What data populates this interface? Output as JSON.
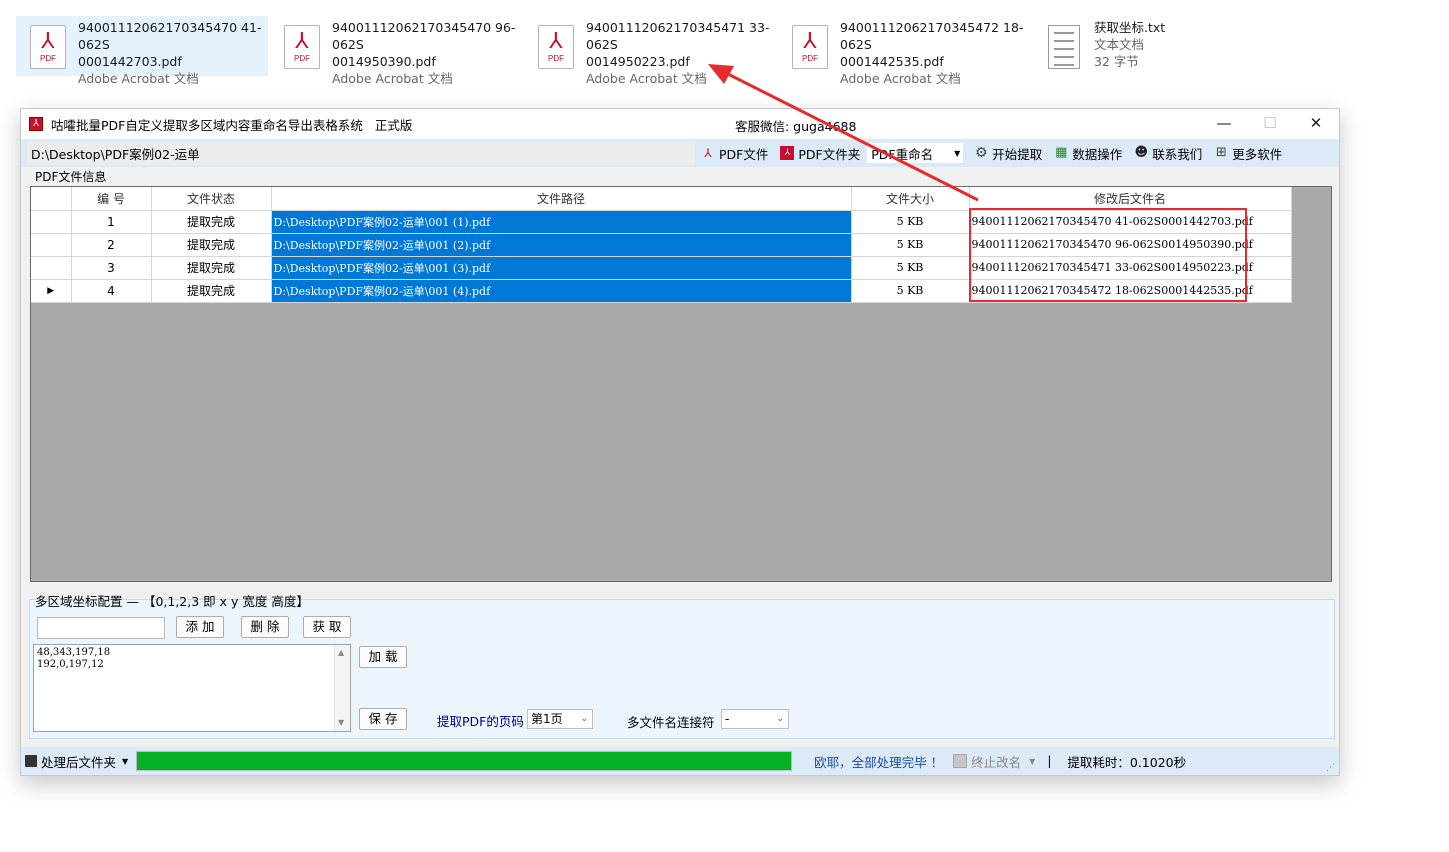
{
  "explorer": {
    "files": [
      {
        "name_line1": "94001112062170345470 41-062S",
        "name_line2": "0001442703.pdf",
        "type": "Adobe Acrobat 文档",
        "icon": "pdf-icon",
        "selected": true
      },
      {
        "name_line1": "94001112062170345470 96-062S",
        "name_line2": "0014950390.pdf",
        "type": "Adobe Acrobat 文档",
        "icon": "pdf-icon"
      },
      {
        "name_line1": "94001112062170345471 33-062S",
        "name_line2": "0014950223.pdf",
        "type": "Adobe Acrobat 文档",
        "icon": "pdf-icon"
      },
      {
        "name_line1": "94001112062170345472 18-062S",
        "name_line2": "0001442535.pdf",
        "type": "Adobe Acrobat 文档",
        "icon": "pdf-icon"
      },
      {
        "name_line1": "获取坐标.txt",
        "name_line2": "文本文档",
        "type": "32 字节",
        "icon": "txt-icon"
      }
    ],
    "pdf_badge": "PDF"
  },
  "window": {
    "title": "咕嚯批量PDF自定义提取多区域内容重命名导出表格系统",
    "edition": "正式版",
    "contact": "客服微信: guga4688",
    "controls": {
      "minimize": "—",
      "maximize": "☐",
      "close": "✕"
    }
  },
  "toolbar": {
    "path": "D:\\Desktop\\PDF案例02-运单",
    "pdf_file": "PDF文件",
    "pdf_folder": "PDF文件夹",
    "mode_select": "PDF重命名",
    "start": "开始提取",
    "data_ops": "数据操作",
    "contact_us": "联系我们",
    "more": "更多软件"
  },
  "grid": {
    "group_label": "PDF文件信息",
    "columns": [
      "编 号",
      "文件状态",
      "文件路径",
      "文件大小",
      "修改后文件名"
    ],
    "rows": [
      {
        "no": "1",
        "status": "提取完成",
        "path": "D:\\Desktop\\PDF案例02-运单\\001 (1).pdf",
        "size": "5 KB",
        "new_name": "94001112062170345470 41-062S0001442703.pdf",
        "current": false
      },
      {
        "no": "2",
        "status": "提取完成",
        "path": "D:\\Desktop\\PDF案例02-运单\\001 (2).pdf",
        "size": "5 KB",
        "new_name": "94001112062170345470 96-062S0014950390.pdf",
        "current": false
      },
      {
        "no": "3",
        "status": "提取完成",
        "path": "D:\\Desktop\\PDF案例02-运单\\001 (3).pdf",
        "size": "5 KB",
        "new_name": "94001112062170345471 33-062S0014950223.pdf",
        "current": false
      },
      {
        "no": "4",
        "status": "提取完成",
        "path": "D:\\Desktop\\PDF案例02-运单\\001 (4).pdf",
        "size": "5 KB",
        "new_name": "94001112062170345472 18-062S0001442535.pdf",
        "current": true
      }
    ],
    "current_row_marker": "▶"
  },
  "config": {
    "label": "多区域坐标配置 — 【0,1,2,3 即 x y 宽度 高度】",
    "add": "添 加",
    "delete": "删 除",
    "get": "获 取",
    "load": "加 载",
    "save": "保 存",
    "coords_text": "48,343,197,18\n192,0,197,12",
    "page_label": "提取PDF的页码",
    "page_value": "第1页",
    "joiner_label": "多文件名连接符",
    "joiner_value": "-"
  },
  "status": {
    "folder": "处理后文件夹",
    "progress": 1.0,
    "message": "欧耶，全部处理完毕 ！",
    "stop_rename": "终止改名",
    "separator": "|",
    "elapsed": "提取耗时：0.1020秒"
  },
  "colors": {
    "selection_blue": "#0078d7",
    "progress_green": "#06b025",
    "highlight_red": "#e52b2b",
    "toolbar_blue": "#dce9f6"
  }
}
